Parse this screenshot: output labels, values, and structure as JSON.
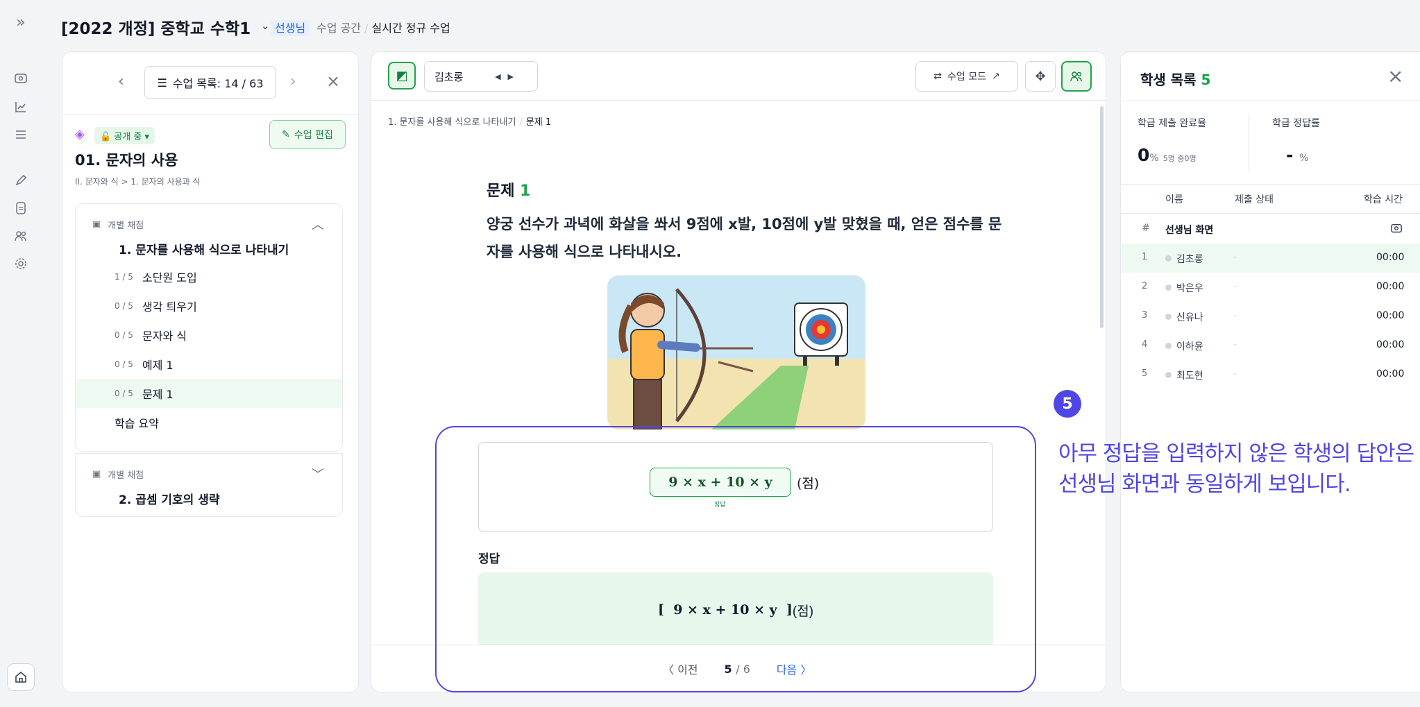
{
  "header": {
    "course_title": "[2022 개정] 중학교 수학1",
    "teacher_tag": "선생님",
    "crumb_space": "수업 공간",
    "crumb_current": "실시간 정규 수업",
    "avatar_text": "생님"
  },
  "left": {
    "list_button": "수업 목록: 14 / 63",
    "public_status": "공개 중",
    "edit_button": "수업 편집",
    "lesson_title": "01. 문자의 사용",
    "lesson_sub": "II. 문자와 식 > 1. 문자의 사용과 식",
    "sections": [
      {
        "grade_label": "개별 채점",
        "title": "1. 문자를 사용해 식으로 나타내기",
        "items": [
          {
            "count": "1 / 5",
            "label": "소단원 도입"
          },
          {
            "count": "0 / 5",
            "label": "생각 틔우기"
          },
          {
            "count": "0 / 5",
            "label": "문자와 식"
          },
          {
            "count": "0 / 5",
            "label": "예제 1"
          },
          {
            "count": "0 / 5",
            "label": "문제 1"
          },
          {
            "count": "",
            "label": "학습 요약"
          }
        ]
      },
      {
        "grade_label": "개별 채점",
        "title": "2. 곱셈 기호의 생략"
      }
    ]
  },
  "middle": {
    "student_name": "김초롱",
    "mode_button": "수업 모드",
    "breadcrumb_section": "1. 문자를 사용해 식으로 나타내기",
    "breadcrumb_current": "문제 1",
    "question_label": "문제",
    "question_number": "1",
    "question_text": "양궁 선수가 과녁에 화살을 쏴서 9점에 x발, 10점에 y발 맞혔을 때, 얻은 점수를 문자를 사용해 식으로 나타내시오.",
    "answer_expression": "9 × x + 10 × y",
    "answer_unit": "(점)",
    "answer_tag": "정답",
    "correct_heading": "정답",
    "correct_expression": "[  9 × x + 10 × y  ]",
    "correct_unit": "(점)",
    "pager": {
      "prev": "〈 이전",
      "page": "5",
      "total": "/ 6",
      "next": "다음 〉"
    }
  },
  "right": {
    "title": "학생 목록",
    "count": "5",
    "stat_submit_label": "학급 제출 완료율",
    "stat_submit_value": "0",
    "stat_submit_unit": "%",
    "stat_submit_detail": "5명 중0명",
    "stat_correct_label": "학급 정답률",
    "stat_correct_value": "-",
    "stat_correct_unit": "%",
    "col_name": "이름",
    "col_status": "제출 상태",
    "col_time": "학습 시간",
    "teacher_row_idx": "#",
    "teacher_row_name": "선생님 화면",
    "students": [
      {
        "idx": "1",
        "name": "김초롱",
        "status": "-",
        "time": "00:00"
      },
      {
        "idx": "2",
        "name": "박은우",
        "status": "-",
        "time": "00:00"
      },
      {
        "idx": "3",
        "name": "신유나",
        "status": "-",
        "time": "00:00"
      },
      {
        "idx": "4",
        "name": "이하윤",
        "status": "-",
        "time": "00:00"
      },
      {
        "idx": "5",
        "name": "최도현",
        "status": "-",
        "time": "00:00"
      }
    ]
  },
  "annotation": {
    "badge": "5",
    "line1": "아무 정답을 입력하지 않은 학생의 답안은",
    "line2": "선생님 화면과 동일하게 보입니다."
  },
  "colors": {
    "accent_green": "#22a14a",
    "annotation": "#4f46e5",
    "teacher_blue": "#2563eb"
  }
}
